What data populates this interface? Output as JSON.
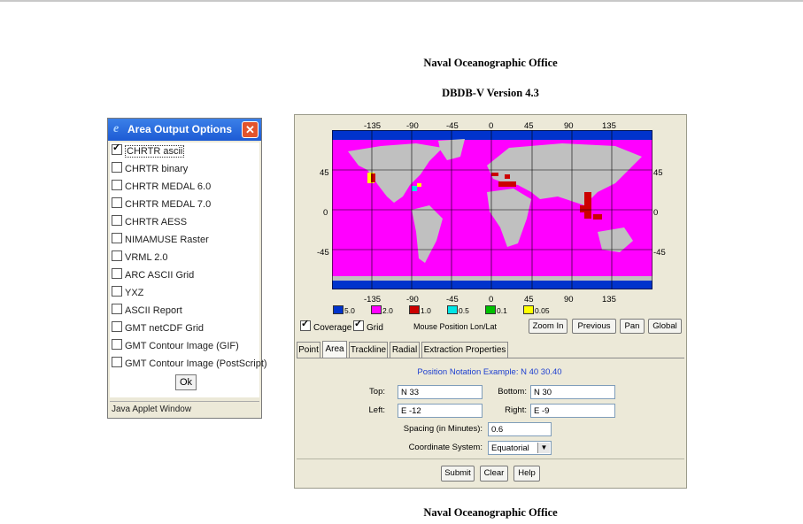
{
  "header": {
    "title": "Naval Oceanographic Office",
    "subtitle": "DBDB-V Version 4.3",
    "footer": "Naval Oceanographic Office"
  },
  "dialog": {
    "title": "Area Output Options",
    "close_icon": "close-icon",
    "app_icon": "ie-icon",
    "options": [
      {
        "label": "CHRTR ascii",
        "checked": true
      },
      {
        "label": "CHRTR binary",
        "checked": false
      },
      {
        "label": "CHRTR MEDAL 6.0",
        "checked": false
      },
      {
        "label": "CHRTR MEDAL 7.0",
        "checked": false
      },
      {
        "label": "CHRTR AESS",
        "checked": false
      },
      {
        "label": "NIMAMUSE Raster",
        "checked": false
      },
      {
        "label": "VRML 2.0",
        "checked": false
      },
      {
        "label": "ARC ASCII Grid",
        "checked": false
      },
      {
        "label": "YXZ",
        "checked": false
      },
      {
        "label": "ASCII Report",
        "checked": false
      },
      {
        "label": "GMT netCDF Grid",
        "checked": false
      },
      {
        "label": "GMT Contour Image (GIF)",
        "checked": false
      },
      {
        "label": "GMT Contour Image (PostScript)",
        "checked": false
      }
    ],
    "ok_label": "Ok",
    "status": "Java Applet Window"
  },
  "map": {
    "top_lon_labels": [
      "-135",
      "-90",
      "-45",
      "0",
      "45",
      "90",
      "135"
    ],
    "bottom_lon_labels": [
      "-135",
      "-90",
      "-45",
      "0",
      "45",
      "90",
      "135"
    ],
    "left_lat_labels": [
      "45",
      "0",
      "-45"
    ],
    "right_lat_labels": [
      "45",
      "0",
      "-45"
    ],
    "colors": {
      "ocean": "#ff00ff",
      "land": "#c0c0c0",
      "deep_top": "#0033cc",
      "deep_bottom": "#0033cc",
      "red": "#cc0000",
      "cyan": "#00e5e5",
      "yellow": "#ffff00"
    },
    "legend": [
      {
        "label": "5.0",
        "color": "#0033cc"
      },
      {
        "label": "2.0",
        "color": "#ff00ff"
      },
      {
        "label": "1.0",
        "color": "#cc0000"
      },
      {
        "label": "0.5",
        "color": "#00e5e5"
      },
      {
        "label": "0.1",
        "color": "#00c000"
      },
      {
        "label": "0.05",
        "color": "#ffff00"
      }
    ]
  },
  "controls": {
    "coverage_label": "Coverage",
    "coverage_checked": true,
    "grid_label": "Grid",
    "grid_checked": true,
    "mouse_position": "Mouse Position Lon/Lat",
    "zoom_in": "Zoom In",
    "previous": "Previous",
    "pan": "Pan",
    "global": "Global"
  },
  "tabs": [
    "Point",
    "Area",
    "Trackline",
    "Radial",
    "Extraction Properties"
  ],
  "active_tab": "Area",
  "area_form": {
    "notation_example": "Position Notation Example: N 40 30.40",
    "top_label": "Top:",
    "top_value": "N 33",
    "bottom_label": "Bottom:",
    "bottom_value": "N 30",
    "left_label": "Left:",
    "left_value": "E -12",
    "right_label": "Right:",
    "right_value": "E -9",
    "spacing_label": "Spacing (in Minutes):",
    "spacing_value": "0.6",
    "coord_label": "Coordinate System:",
    "coord_value": "Equatorial"
  },
  "actions": {
    "submit": "Submit",
    "clear": "Clear",
    "help": "Help"
  }
}
